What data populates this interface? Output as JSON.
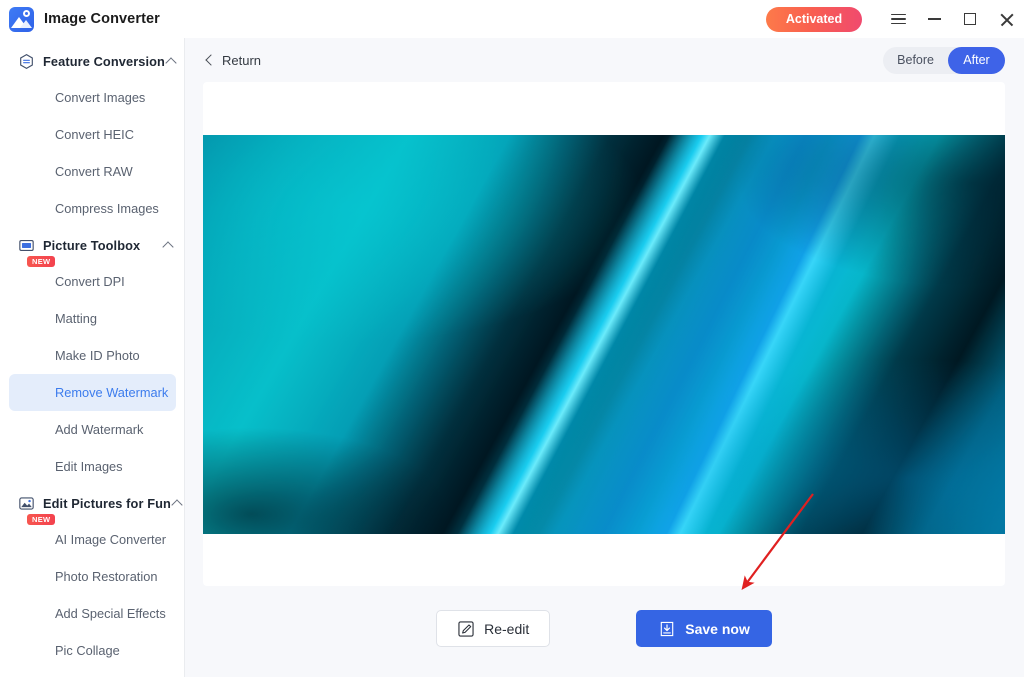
{
  "titlebar": {
    "app_name": "Image Converter",
    "logo_icon": "image-logo-icon",
    "activated_label": "Activated",
    "menu_icon": "hamburger-menu-icon",
    "minimize_icon": "minimize-icon",
    "maximize_icon": "maximize-icon",
    "close_icon": "close-icon"
  },
  "sidebar": {
    "groups": [
      {
        "label": "Feature Conversion",
        "icon": "feature-conversion-icon",
        "expanded": true,
        "items": [
          {
            "label": "Convert Images",
            "active": false,
            "badge": ""
          },
          {
            "label": "Convert HEIC",
            "active": false,
            "badge": ""
          },
          {
            "label": "Convert RAW",
            "active": false,
            "badge": ""
          },
          {
            "label": "Compress Images",
            "active": false,
            "badge": ""
          }
        ]
      },
      {
        "label": "Picture Toolbox",
        "icon": "picture-toolbox-icon",
        "expanded": true,
        "items": [
          {
            "label": "Convert DPI",
            "active": false,
            "badge": "NEW"
          },
          {
            "label": "Matting",
            "active": false,
            "badge": ""
          },
          {
            "label": "Make ID Photo",
            "active": false,
            "badge": ""
          },
          {
            "label": "Remove Watermark",
            "active": true,
            "badge": ""
          },
          {
            "label": "Add Watermark",
            "active": false,
            "badge": ""
          },
          {
            "label": "Edit Images",
            "active": false,
            "badge": ""
          }
        ]
      },
      {
        "label": "Edit Pictures for Fun",
        "icon": "edit-pictures-icon",
        "expanded": true,
        "items": [
          {
            "label": "AI Image Converter",
            "active": false,
            "badge": "NEW"
          },
          {
            "label": "Photo Restoration",
            "active": false,
            "badge": ""
          },
          {
            "label": "Add Special Effects",
            "active": false,
            "badge": ""
          },
          {
            "label": "Pic Collage",
            "active": false,
            "badge": ""
          }
        ]
      }
    ]
  },
  "content": {
    "return_label": "Return",
    "return_icon": "chevron-left-icon",
    "compare_toggle": {
      "before_label": "Before",
      "after_label": "After",
      "selected": "After"
    },
    "preview": {
      "description": "Abstract teal and cyan gradient image with diagonal light streaks",
      "alt_name": "result-image"
    },
    "annotation": {
      "type": "arrow",
      "color": "#e02020",
      "points_from": "813,500",
      "points_to": "740,597"
    },
    "actions": {
      "reedit_label": "Re-edit",
      "reedit_icon": "pencil-edit-icon",
      "save_label": "Save now",
      "save_icon": "download-save-icon"
    }
  },
  "colors": {
    "accent_blue": "#3565e4",
    "toggle_active": "#3e63e8",
    "sidebar_active_bg": "#e4edfb",
    "sidebar_active_text": "#3c7ced",
    "badge_red": "#f3424e",
    "activated_gradient_start": "#fd7a4a",
    "activated_gradient_end": "#f04a6e",
    "arrow_red": "#e02020",
    "content_bg": "#f7f8fb"
  }
}
